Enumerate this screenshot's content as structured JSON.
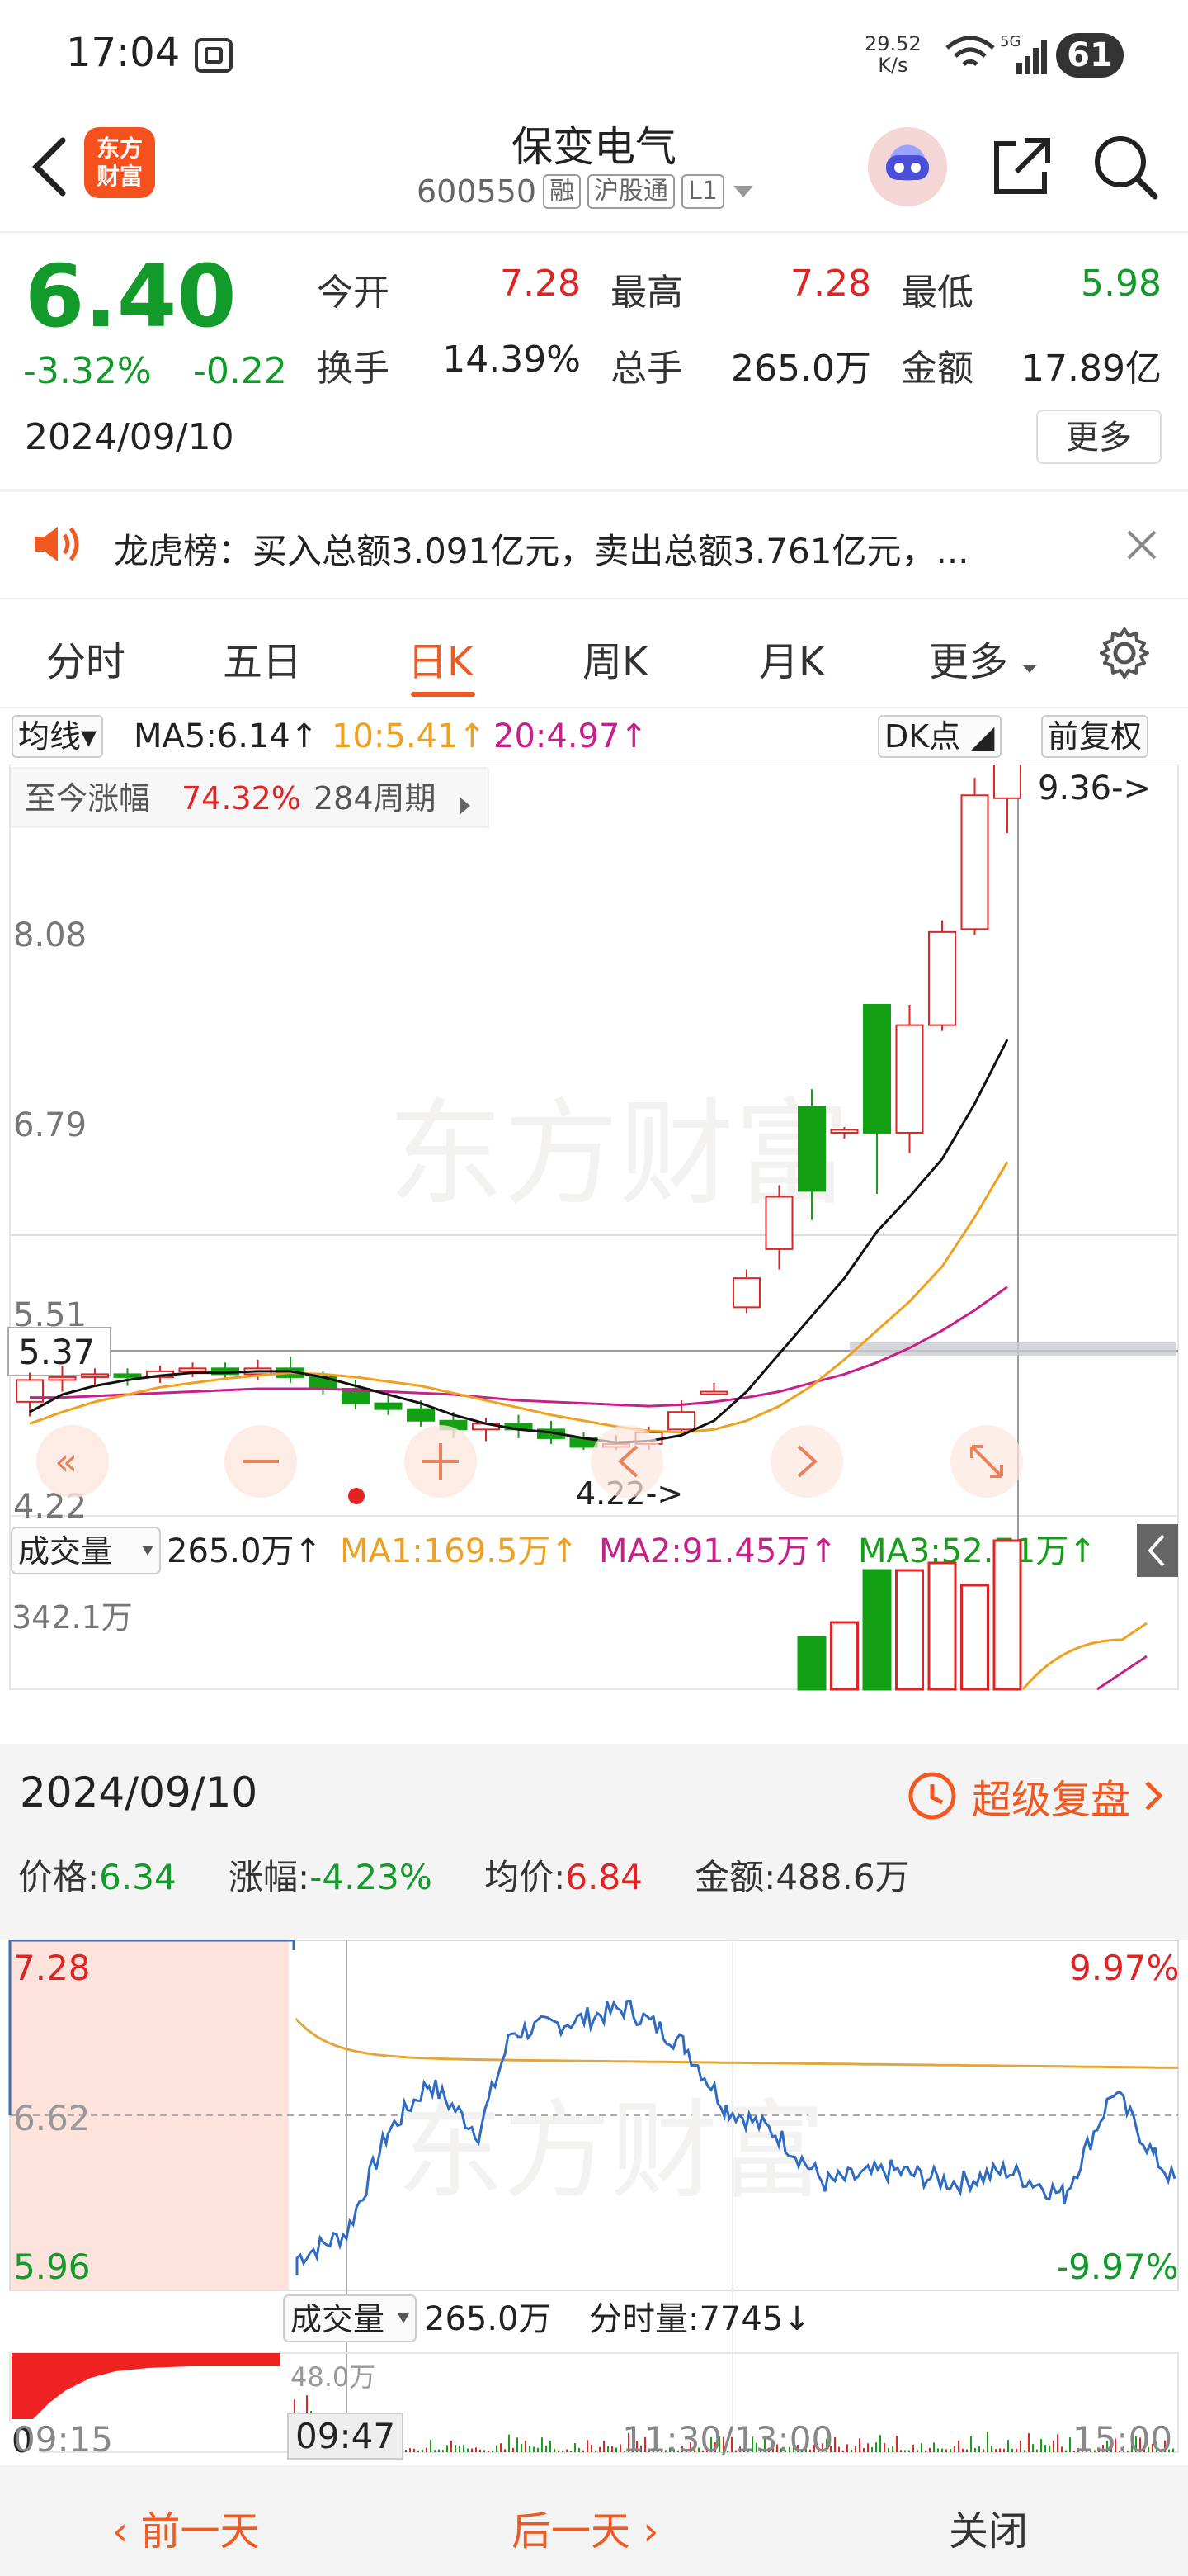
{
  "status_bar": {
    "time": "17:04",
    "net_speed": "29.52",
    "net_unit": "K/s",
    "battery": "61"
  },
  "header": {
    "logo_line1": "东方",
    "logo_line2": "财富",
    "stock_name": "保变电气",
    "stock_code": "600550",
    "tag_margin": "融",
    "tag_connect": "沪股通",
    "tag_level": "L1"
  },
  "quote": {
    "price": "6.40",
    "change_pct": "-3.32%",
    "change_amt": "-0.22",
    "date": "2024/09/10",
    "open_label": "今开",
    "open_value": "7.28",
    "high_label": "最高",
    "high_value": "7.28",
    "low_label": "最低",
    "low_value": "5.98",
    "turnover_label": "换手",
    "turnover_value": "14.39%",
    "volume_label": "总手",
    "volume_value": "265.0万",
    "amount_label": "金额",
    "amount_value": "17.89亿",
    "more_label": "更多"
  },
  "banner": {
    "text": "龙虎榜：买入总额3.091亿元，卖出总额3.761亿元，..."
  },
  "tabs": [
    "分时",
    "五日",
    "日K",
    "周K",
    "月K",
    "更多"
  ],
  "kline": {
    "ma_selector": "均线",
    "ma5": "MA5:6.14↑",
    "ma10": "10:5.41↑",
    "ma20": "20:4.97↑",
    "dk_label": "DK点",
    "adjust_label": "前复权",
    "gain_label": "至今涨幅",
    "gain_value": "74.32%",
    "gain_period": "284周期",
    "price_ticks": [
      "8.08",
      "6.79",
      "5.51",
      "4.22"
    ],
    "crosshair_price": "5.37",
    "high_marker": "9.36->",
    "low_marker": "4.22->",
    "watermark": "东方财富",
    "vol_selector": "成交量",
    "vol_value": "265.0万↑",
    "vol_ma1": "MA1:169.5万↑",
    "vol_ma2": "MA2:91.45万↑",
    "vol_ma3": "MA3:52.71万↑",
    "vol_max": "342.1万",
    "colors": {
      "up": "#e02424",
      "down": "#14a014",
      "ma5": "#111111",
      "ma10": "#f0a020",
      "ma20": "#c8208a"
    }
  },
  "intraday": {
    "date": "2024/09/10",
    "replay_label": "超级复盘",
    "price_label": "价格:",
    "price_value": "6.34",
    "chg_label": "涨幅:",
    "chg_value": "-4.23%",
    "avg_label": "均价:",
    "avg_value": "6.84",
    "amount_label": "金额:",
    "amount_value": "488.6万",
    "top_price": "7.28",
    "mid_price": "6.62",
    "low_price": "5.96",
    "top_pct": "9.97%",
    "low_pct": "-9.97%",
    "vol_selector": "成交量",
    "vol_total": "265.0万",
    "tick_label": "分时量:7745↓",
    "vol_peak": "48.0万",
    "vol_zero": "0",
    "time_ticks": [
      "09:15",
      "11:30/13:00",
      "15:00"
    ],
    "cursor_time": "09:47"
  },
  "footer": {
    "prev_day": "前一天",
    "next_day": "后一天",
    "close": "关闭"
  }
}
